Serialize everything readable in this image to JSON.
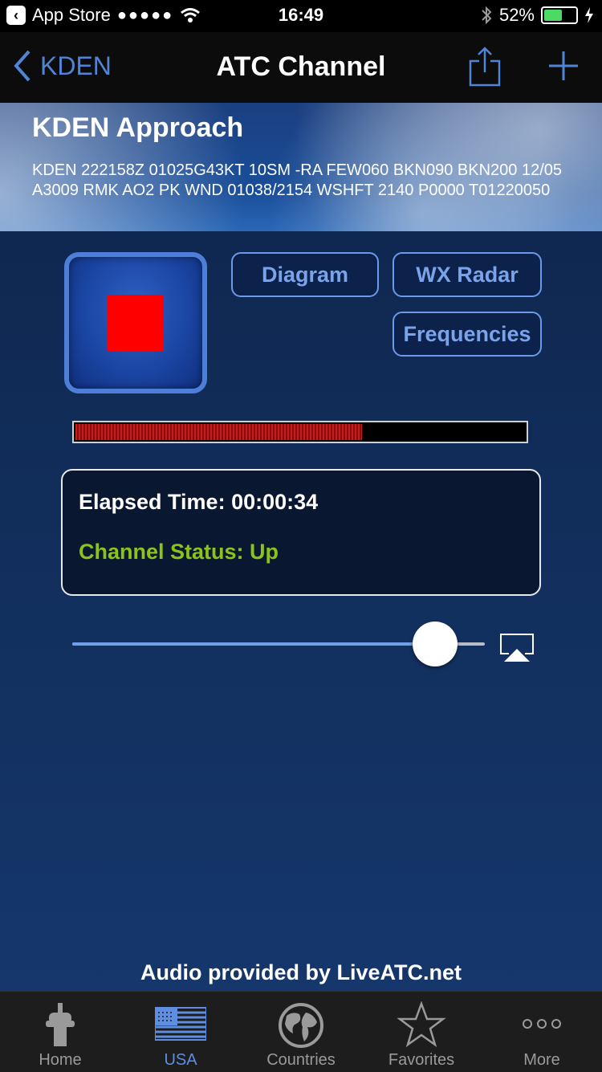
{
  "status_bar": {
    "app_back": "App Store",
    "signal_dots": "●●●●●",
    "time": "16:49",
    "battery": "52%"
  },
  "nav": {
    "back_label": "KDEN",
    "title": "ATC Channel"
  },
  "header": {
    "title": "KDEN Approach",
    "metar": "KDEN 222158Z 01025G43KT 10SM -RA FEW060 BKN090 BKN200 12/05 A3009 RMK AO2 PK WND 01038/2154 WSHFT 2140 P0000 T01220050"
  },
  "controls": {
    "diagram": "Diagram",
    "wx_radar": "WX Radar",
    "frequencies": "Frequencies"
  },
  "audio_level": 0.64,
  "status_panel": {
    "elapsed": "Elapsed Time: 00:00:34",
    "channel_status": "Channel Status: Up"
  },
  "volume": 0.88,
  "colors": {
    "accent": "#4f84d6",
    "status_green": "#8bc418",
    "stop_red": "#ff0000"
  },
  "credit": "Audio provided by LiveATC.net",
  "tabs": [
    {
      "label": "Home",
      "icon": "tower-icon"
    },
    {
      "label": "USA",
      "icon": "flag-icon"
    },
    {
      "label": "Countries",
      "icon": "globe-icon"
    },
    {
      "label": "Favorites",
      "icon": "star-icon"
    },
    {
      "label": "More",
      "icon": "more-icon"
    }
  ],
  "active_tab": "USA"
}
